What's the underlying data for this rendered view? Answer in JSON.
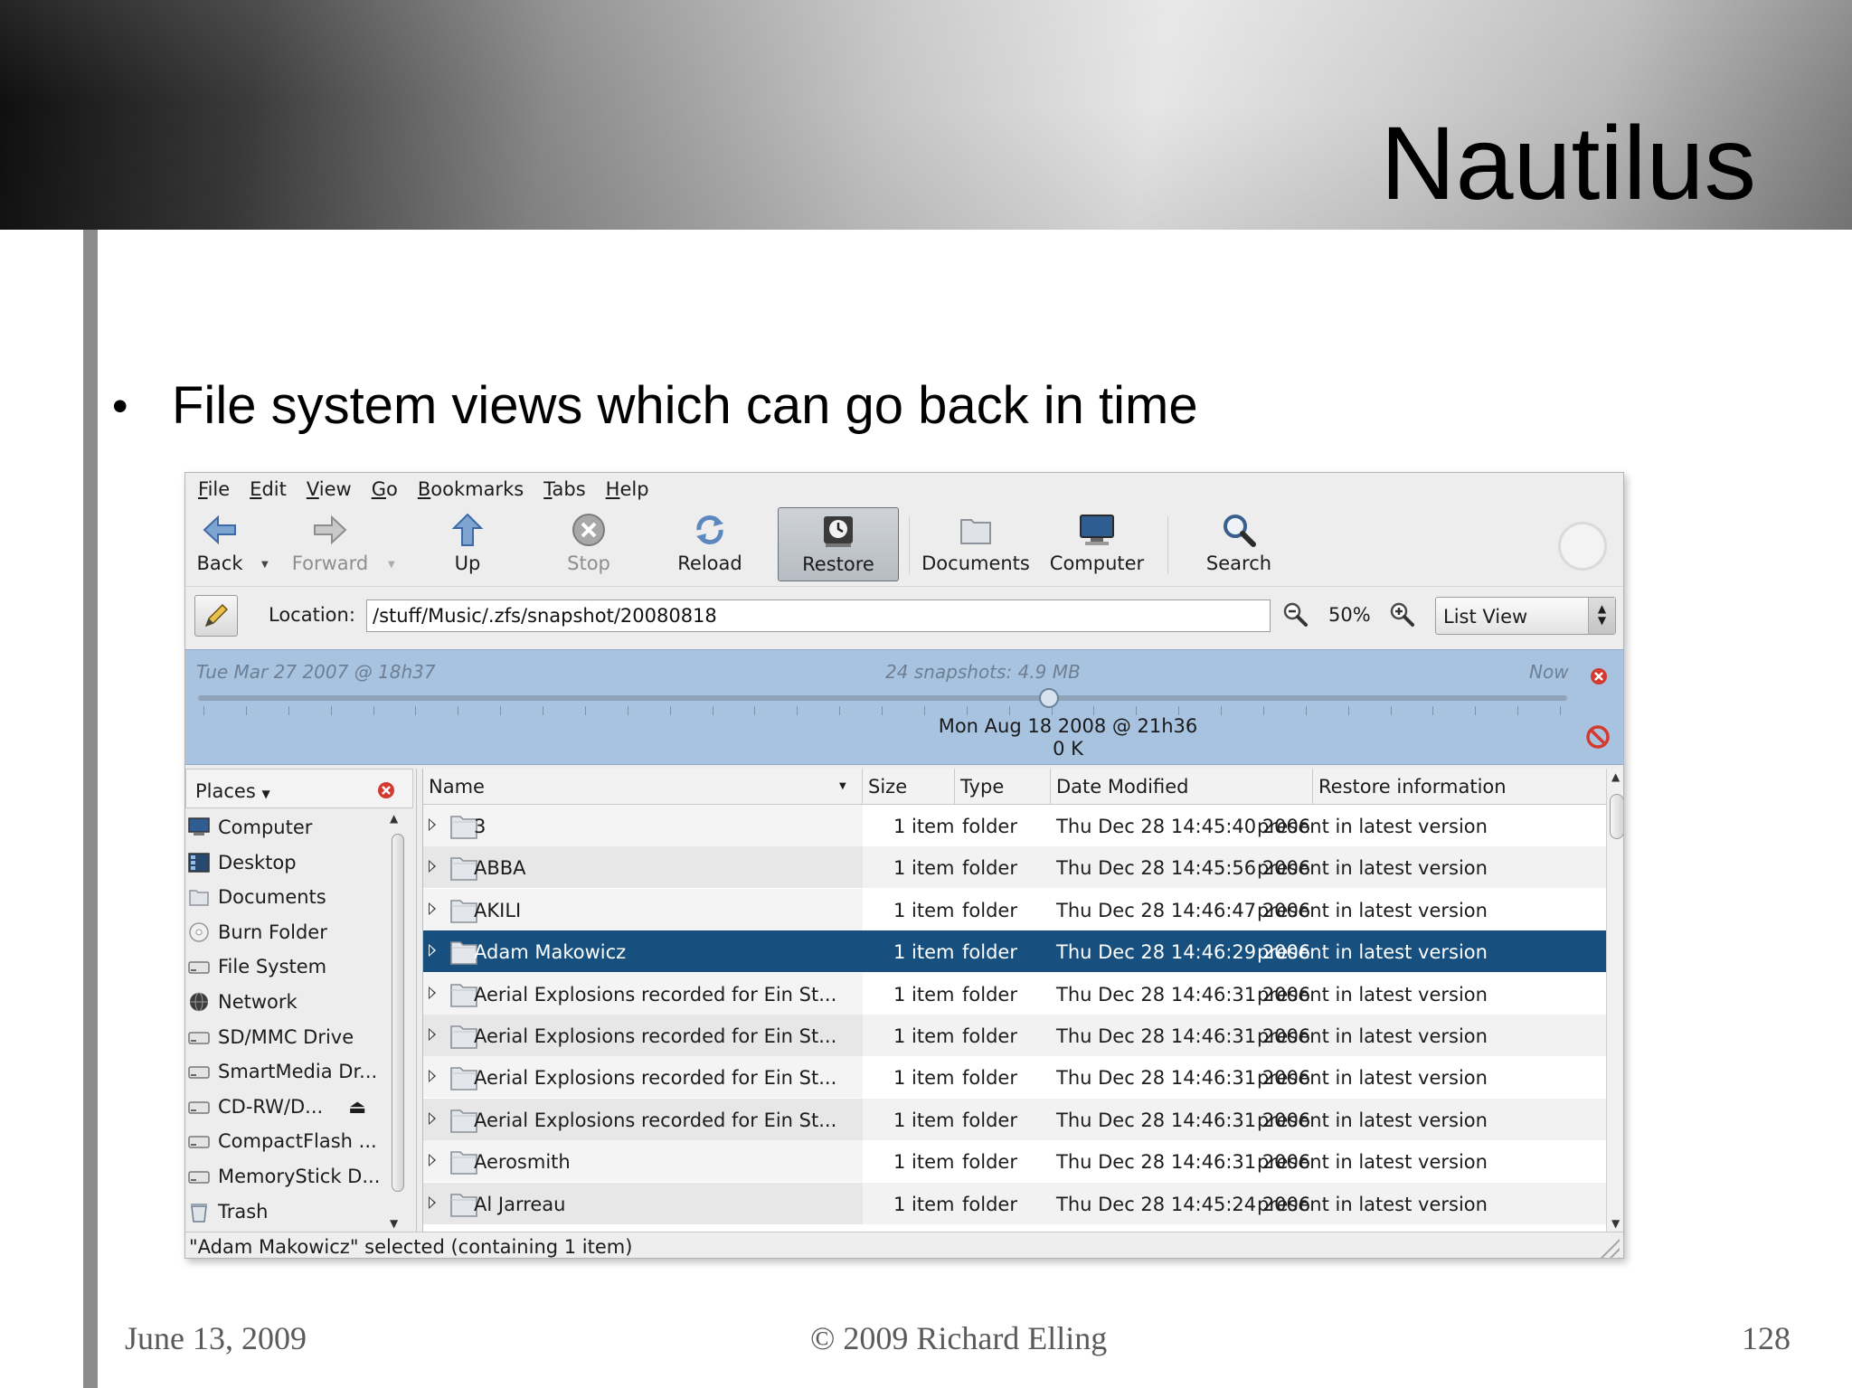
{
  "slide": {
    "title": "Nautilus",
    "bullet": "File system views which can go back in time",
    "footer_date": "June 13, 2009",
    "footer_copyright": "© 2009 Richard Elling",
    "footer_page": "128"
  },
  "menubar": [
    "File",
    "Edit",
    "View",
    "Go",
    "Bookmarks",
    "Tabs",
    "Help"
  ],
  "toolbar": {
    "back": "Back",
    "forward": "Forward",
    "up": "Up",
    "stop": "Stop",
    "reload": "Reload",
    "restore": "Restore",
    "documents": "Documents",
    "computer": "Computer",
    "search": "Search"
  },
  "location": {
    "label": "Location:",
    "value": "/stuff/Music/.zfs/snapshot/20080818",
    "zoom": "50%",
    "view": "List View"
  },
  "timeline": {
    "start": "Tue Mar 27 2007 @ 18h37",
    "count": "24 snapshots: 4.9 MB",
    "end": "Now",
    "selected_date": "Mon Aug 18 2008 @ 21h36",
    "selected_size": "0 K"
  },
  "places": {
    "header": "Places",
    "items": [
      {
        "label": "Computer",
        "icon": "computer-icon"
      },
      {
        "label": "Desktop",
        "icon": "desktop-icon"
      },
      {
        "label": "Documents",
        "icon": "folder-icon"
      },
      {
        "label": "Burn Folder",
        "icon": "disc-icon"
      },
      {
        "label": "File System",
        "icon": "drive-icon"
      },
      {
        "label": "Network",
        "icon": "network-icon"
      },
      {
        "label": "SD/MMC Drive",
        "icon": "drive-icon"
      },
      {
        "label": "SmartMedia Dr...",
        "icon": "drive-icon"
      },
      {
        "label": "CD-RW/D...",
        "icon": "drive-icon"
      },
      {
        "label": "CompactFlash ...",
        "icon": "drive-icon"
      },
      {
        "label": "MemoryStick D...",
        "icon": "drive-icon"
      },
      {
        "label": "Trash",
        "icon": "trash-icon"
      }
    ]
  },
  "columns": {
    "name": "Name",
    "size": "Size",
    "type": "Type",
    "date": "Date Modified",
    "restore": "Restore information"
  },
  "files": [
    {
      "name": "3",
      "size": "1 item",
      "type": "folder",
      "date": "Thu Dec 28 14:45:40 2006",
      "restore": "present in latest version"
    },
    {
      "name": "ABBA",
      "size": "1 item",
      "type": "folder",
      "date": "Thu Dec 28 14:45:56 2006",
      "restore": "present in latest version"
    },
    {
      "name": "AKILI",
      "size": "1 item",
      "type": "folder",
      "date": "Thu Dec 28 14:46:47 2006",
      "restore": "present in latest version"
    },
    {
      "name": "Adam Makowicz",
      "size": "1 item",
      "type": "folder",
      "date": "Thu Dec 28 14:46:29 2006",
      "restore": "present in latest version",
      "selected": true
    },
    {
      "name": "Aerial Explosions recorded for Ein St...",
      "size": "1 item",
      "type": "folder",
      "date": "Thu Dec 28 14:46:31 2006",
      "restore": "present in latest version"
    },
    {
      "name": "Aerial Explosions recorded for Ein St...",
      "size": "1 item",
      "type": "folder",
      "date": "Thu Dec 28 14:46:31 2006",
      "restore": "present in latest version"
    },
    {
      "name": "Aerial Explosions recorded for Ein St...",
      "size": "1 item",
      "type": "folder",
      "date": "Thu Dec 28 14:46:31 2006",
      "restore": "present in latest version"
    },
    {
      "name": "Aerial Explosions recorded for Ein St...",
      "size": "1 item",
      "type": "folder",
      "date": "Thu Dec 28 14:46:31 2006",
      "restore": "present in latest version"
    },
    {
      "name": "Aerosmith",
      "size": "1 item",
      "type": "folder",
      "date": "Thu Dec 28 14:46:31 2006",
      "restore": "present in latest version"
    },
    {
      "name": "Al Jarreau",
      "size": "1 item",
      "type": "folder",
      "date": "Thu Dec 28 14:45:24 2006",
      "restore": "present in latest version"
    }
  ],
  "status": "\"Adam Makowicz\" selected (containing 1 item)"
}
